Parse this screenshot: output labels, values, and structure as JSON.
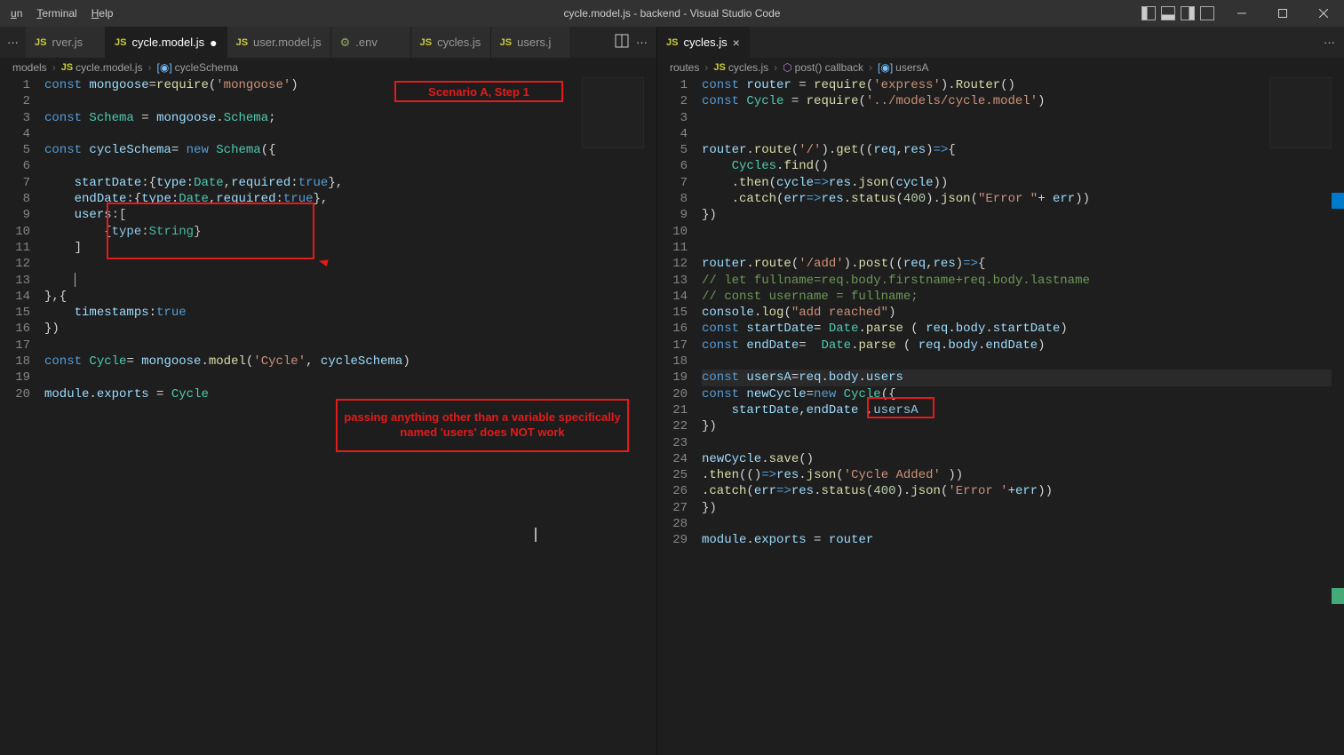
{
  "menu": {
    "items": [
      "un",
      "Terminal",
      "Help"
    ]
  },
  "window_title": "cycle.model.js - backend - Visual Studio Code",
  "left_tabs": [
    {
      "label": "rver.js",
      "type": "js",
      "active": false,
      "overflow": true
    },
    {
      "label": "cycle.model.js",
      "type": "js",
      "active": true,
      "dirty": true
    },
    {
      "label": "user.model.js",
      "type": "js",
      "active": false
    },
    {
      "label": ".env",
      "type": "env",
      "active": false
    },
    {
      "label": "cycles.js",
      "type": "js",
      "active": false
    },
    {
      "label": "users.js",
      "type": "js",
      "active": false,
      "trimmed": true
    }
  ],
  "right_tabs": [
    {
      "label": "cycles.js",
      "type": "js",
      "active": true
    }
  ],
  "breadcrumbs_left": [
    "models",
    "cycle.model.js",
    "cycleSchema"
  ],
  "breadcrumbs_right": [
    "routes",
    "cycles.js",
    "post() callback",
    "usersA"
  ],
  "annotations": {
    "a1_label": "Scenario A, Step 1",
    "a2_label": "passing anything other than a variable specifically named 'users' does NOT work"
  },
  "left_code": [
    {
      "n": 1,
      "html": "<span class='tk-kw'>const</span> <span class='tk-var'>mongoose</span><span class='tk-punc'>=</span><span class='tk-fn'>require</span><span class='tk-punc'>(</span><span class='tk-str'>'mongoose'</span><span class='tk-punc'>)</span>"
    },
    {
      "n": 2,
      "html": ""
    },
    {
      "n": 3,
      "html": "<span class='tk-kw'>const</span> <span class='tk-cls'>Schema</span> <span class='tk-punc'>=</span> <span class='tk-var'>mongoose</span><span class='tk-punc'>.</span><span class='tk-cls'>Schema</span><span class='tk-punc'>;</span>"
    },
    {
      "n": 4,
      "html": ""
    },
    {
      "n": 5,
      "html": "<span class='tk-kw'>const</span> <span class='tk-var'>cycleSchema</span><span class='tk-punc'>=</span> <span class='tk-kw'>new</span> <span class='tk-cls'>Schema</span><span class='tk-punc'>({</span>"
    },
    {
      "n": 6,
      "html": ""
    },
    {
      "n": 7,
      "html": "    <span class='tk-prop'>startDate</span><span class='tk-punc'>:{</span><span class='tk-prop'>type</span><span class='tk-punc'>:</span><span class='tk-cls'>Date</span><span class='tk-punc'>,</span><span class='tk-prop'>required</span><span class='tk-punc'>:</span><span class='tk-kw'>true</span><span class='tk-punc'>},</span>"
    },
    {
      "n": 8,
      "html": "    <span class='tk-prop'>endDate</span><span class='tk-punc'>:{</span><span class='tk-prop'>type</span><span class='tk-punc'>:</span><span class='tk-cls'>Date</span><span class='tk-punc'>,</span><span class='tk-prop'>required</span><span class='tk-punc'>:</span><span class='tk-kw'>true</span><span class='tk-punc'>},</span>"
    },
    {
      "n": 9,
      "html": "    <span class='tk-prop'>users</span><span class='tk-punc'>:[</span>"
    },
    {
      "n": 10,
      "html": "        <span class='tk-punc'>{</span><span class='tk-prop'>type</span><span class='tk-punc'>:</span><span class='tk-cls'>String</span><span class='tk-punc'>}</span>"
    },
    {
      "n": 11,
      "html": "    <span class='tk-punc'>]</span>"
    },
    {
      "n": 12,
      "html": ""
    },
    {
      "n": 13,
      "html": "    <span class='cursor'></span>"
    },
    {
      "n": 14,
      "html": "<span class='tk-punc'>},{</span>"
    },
    {
      "n": 15,
      "html": "    <span class='tk-prop'>timestamps</span><span class='tk-punc'>:</span><span class='tk-kw'>true</span>"
    },
    {
      "n": 16,
      "html": "<span class='tk-punc'>})</span>"
    },
    {
      "n": 17,
      "html": ""
    },
    {
      "n": 18,
      "html": "<span class='tk-kw'>const</span> <span class='tk-cls'>Cycle</span><span class='tk-punc'>=</span> <span class='tk-var'>mongoose</span><span class='tk-punc'>.</span><span class='tk-fn'>model</span><span class='tk-punc'>(</span><span class='tk-str'>'Cycle'</span><span class='tk-punc'>,</span> <span class='tk-var'>cycleSchema</span><span class='tk-punc'>)</span>"
    },
    {
      "n": 19,
      "html": ""
    },
    {
      "n": 20,
      "html": "<span class='tk-var'>module</span><span class='tk-punc'>.</span><span class='tk-var'>exports</span> <span class='tk-punc'>=</span> <span class='tk-cls'>Cycle</span>"
    }
  ],
  "right_code": [
    {
      "n": 1,
      "html": "<span class='tk-kw'>const</span> <span class='tk-var'>router</span> <span class='tk-punc'>=</span> <span class='tk-fn'>require</span><span class='tk-punc'>(</span><span class='tk-str'>'express'</span><span class='tk-punc'>).</span><span class='tk-fn'>Router</span><span class='tk-punc'>()</span>"
    },
    {
      "n": 2,
      "html": "<span class='tk-kw'>const</span> <span class='tk-cls'>Cycle</span> <span class='tk-punc'>=</span> <span class='tk-fn'>require</span><span class='tk-punc'>(</span><span class='tk-str'>'../models/cycle.model'</span><span class='tk-punc'>)</span>"
    },
    {
      "n": 3,
      "html": ""
    },
    {
      "n": 4,
      "html": ""
    },
    {
      "n": 5,
      "html": "<span class='tk-var'>router</span><span class='tk-punc'>.</span><span class='tk-fn'>route</span><span class='tk-punc'>(</span><span class='tk-str'>'/'</span><span class='tk-punc'>).</span><span class='tk-fn'>get</span><span class='tk-punc'>((</span><span class='tk-var'>req</span><span class='tk-punc'>,</span><span class='tk-var'>res</span><span class='tk-punc'>)</span><span class='tk-kw'>=></span><span class='tk-punc'>{</span>"
    },
    {
      "n": 6,
      "html": "    <span class='tk-cls'>Cycles</span><span class='tk-punc'>.</span><span class='tk-fn'>find</span><span class='tk-punc'>()</span>"
    },
    {
      "n": 7,
      "html": "    <span class='tk-punc'>.</span><span class='tk-fn'>then</span><span class='tk-punc'>(</span><span class='tk-var'>cycle</span><span class='tk-kw'>=></span><span class='tk-var'>res</span><span class='tk-punc'>.</span><span class='tk-fn'>json</span><span class='tk-punc'>(</span><span class='tk-var'>cycle</span><span class='tk-punc'>))</span>"
    },
    {
      "n": 8,
      "html": "    <span class='tk-punc'>.</span><span class='tk-fn'>catch</span><span class='tk-punc'>(</span><span class='tk-var'>err</span><span class='tk-kw'>=></span><span class='tk-var'>res</span><span class='tk-punc'>.</span><span class='tk-fn'>status</span><span class='tk-punc'>(</span><span class='tk-num'>400</span><span class='tk-punc'>).</span><span class='tk-fn'>json</span><span class='tk-punc'>(</span><span class='tk-str'>\"Error \"</span><span class='tk-punc'>+ </span><span class='tk-var'>err</span><span class='tk-punc'>))</span>"
    },
    {
      "n": 9,
      "html": "<span class='tk-punc'>})</span>"
    },
    {
      "n": 10,
      "html": ""
    },
    {
      "n": 11,
      "html": ""
    },
    {
      "n": 12,
      "html": "<span class='tk-var'>router</span><span class='tk-punc'>.</span><span class='tk-fn'>route</span><span class='tk-punc'>(</span><span class='tk-str'>'/add'</span><span class='tk-punc'>).</span><span class='tk-fn'>post</span><span class='tk-punc'>((</span><span class='tk-var'>req</span><span class='tk-punc'>,</span><span class='tk-var'>res</span><span class='tk-punc'>)</span><span class='tk-kw'>=></span><span class='tk-punc'>{</span>"
    },
    {
      "n": 13,
      "html": "<span class='tk-cmt'>// let fullname=req.body.firstname+req.body.lastname</span>"
    },
    {
      "n": 14,
      "html": "<span class='tk-cmt'>// const username = fullname;</span>"
    },
    {
      "n": 15,
      "html": "<span class='tk-var'>console</span><span class='tk-punc'>.</span><span class='tk-fn'>log</span><span class='tk-punc'>(</span><span class='tk-str'>\"add reached\"</span><span class='tk-punc'>)</span>"
    },
    {
      "n": 16,
      "html": "<span class='tk-kw'>const</span> <span class='tk-var'>startDate</span><span class='tk-punc'>=</span> <span class='tk-cls'>Date</span><span class='tk-punc'>.</span><span class='tk-fn'>parse</span> <span class='tk-punc'>(</span> <span class='tk-var'>req</span><span class='tk-punc'>.</span><span class='tk-var'>body</span><span class='tk-punc'>.</span><span class='tk-var'>startDate</span><span class='tk-punc'>)</span>"
    },
    {
      "n": 17,
      "html": "<span class='tk-kw'>const</span> <span class='tk-var'>endDate</span><span class='tk-punc'>=</span>  <span class='tk-cls'>Date</span><span class='tk-punc'>.</span><span class='tk-fn'>parse</span> <span class='tk-punc'>(</span> <span class='tk-var'>req</span><span class='tk-punc'>.</span><span class='tk-var'>body</span><span class='tk-punc'>.</span><span class='tk-var'>endDate</span><span class='tk-punc'>)</span>"
    },
    {
      "n": 18,
      "html": ""
    },
    {
      "n": 19,
      "html": "<span class='tk-kw'>const</span> <span class='tk-var'>usersA</span><span class='tk-punc'>=</span><span class='tk-var'>req</span><span class='tk-punc'>.</span><span class='tk-var'>body</span><span class='tk-punc'>.</span><span class='tk-var'>users</span>",
      "hl": true
    },
    {
      "n": 20,
      "html": "<span class='tk-kw'>const</span> <span class='tk-var'>newCycle</span><span class='tk-punc'>=</span><span class='tk-kw'>new</span> <span class='tk-cls'>Cycle</span><span class='tk-punc'>({</span>"
    },
    {
      "n": 21,
      "html": "    <span class='tk-var'>startDate</span><span class='tk-punc'>,</span><span class='tk-var'>endDate</span> <span class='tk-punc'>,</span><span class='tk-var'>usersA</span>"
    },
    {
      "n": 22,
      "html": "<span class='tk-punc'>})</span>"
    },
    {
      "n": 23,
      "html": ""
    },
    {
      "n": 24,
      "html": "<span class='tk-var'>newCycle</span><span class='tk-punc'>.</span><span class='tk-fn'>save</span><span class='tk-punc'>()</span>"
    },
    {
      "n": 25,
      "html": "<span class='tk-punc'>.</span><span class='tk-fn'>then</span><span class='tk-punc'>(()</span><span class='tk-kw'>=></span><span class='tk-var'>res</span><span class='tk-punc'>.</span><span class='tk-fn'>json</span><span class='tk-punc'>(</span><span class='tk-str'>'Cycle Added'</span> <span class='tk-punc'>))</span>"
    },
    {
      "n": 26,
      "html": "<span class='tk-punc'>.</span><span class='tk-fn'>catch</span><span class='tk-punc'>(</span><span class='tk-var'>err</span><span class='tk-kw'>=></span><span class='tk-var'>res</span><span class='tk-punc'>.</span><span class='tk-fn'>status</span><span class='tk-punc'>(</span><span class='tk-num'>400</span><span class='tk-punc'>).</span><span class='tk-fn'>json</span><span class='tk-punc'>(</span><span class='tk-str'>'Error '</span><span class='tk-punc'>+</span><span class='tk-var'>err</span><span class='tk-punc'>))</span>"
    },
    {
      "n": 27,
      "html": "<span class='tk-punc'>})</span>"
    },
    {
      "n": 28,
      "html": ""
    },
    {
      "n": 29,
      "html": "<span class='tk-var'>module</span><span class='tk-punc'>.</span><span class='tk-var'>exports</span> <span class='tk-punc'>=</span> <span class='tk-var'>router</span>"
    }
  ]
}
